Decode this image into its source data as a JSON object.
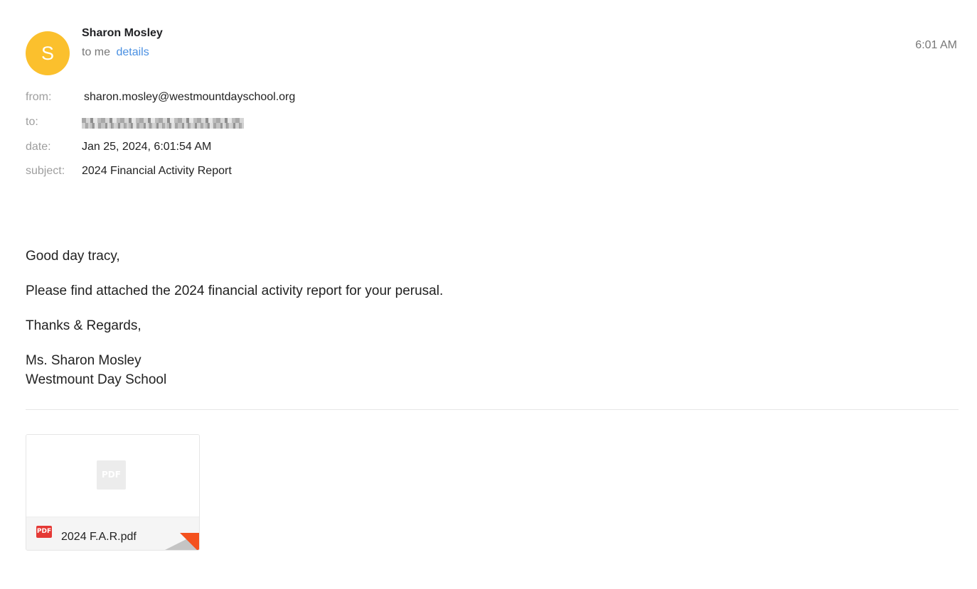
{
  "header": {
    "avatar_letter": "S",
    "avatar_color": "#fbc02d",
    "sender_name": "Sharon Mosley",
    "to_label": "to me",
    "details_link": "details",
    "time": "6:01 AM"
  },
  "details": {
    "from_label": "from:",
    "from_value": "sharon.mosley@westmountdayschool.org",
    "to_label": "to:",
    "to_value_redacted": true,
    "date_label": "date:",
    "date_value": "Jan 25, 2024, 6:01:54 AM",
    "subject_label": "subject:",
    "subject_value": "2024 Financial Activity Report"
  },
  "body": {
    "greeting": "Good day tracy,",
    "message": "Please find attached the 2024 financial activity report for your perusal.",
    "closing": "Thanks & Regards,",
    "signature_name": "Ms. Sharon Mosley",
    "signature_org": "Westmount Day School"
  },
  "attachment": {
    "preview_icon_text": "PDF",
    "file_icon_text": "PDF",
    "file_name": "2024 F.A.R.pdf",
    "icon": "pdf-file-icon",
    "accent_color": "#f4511e"
  }
}
